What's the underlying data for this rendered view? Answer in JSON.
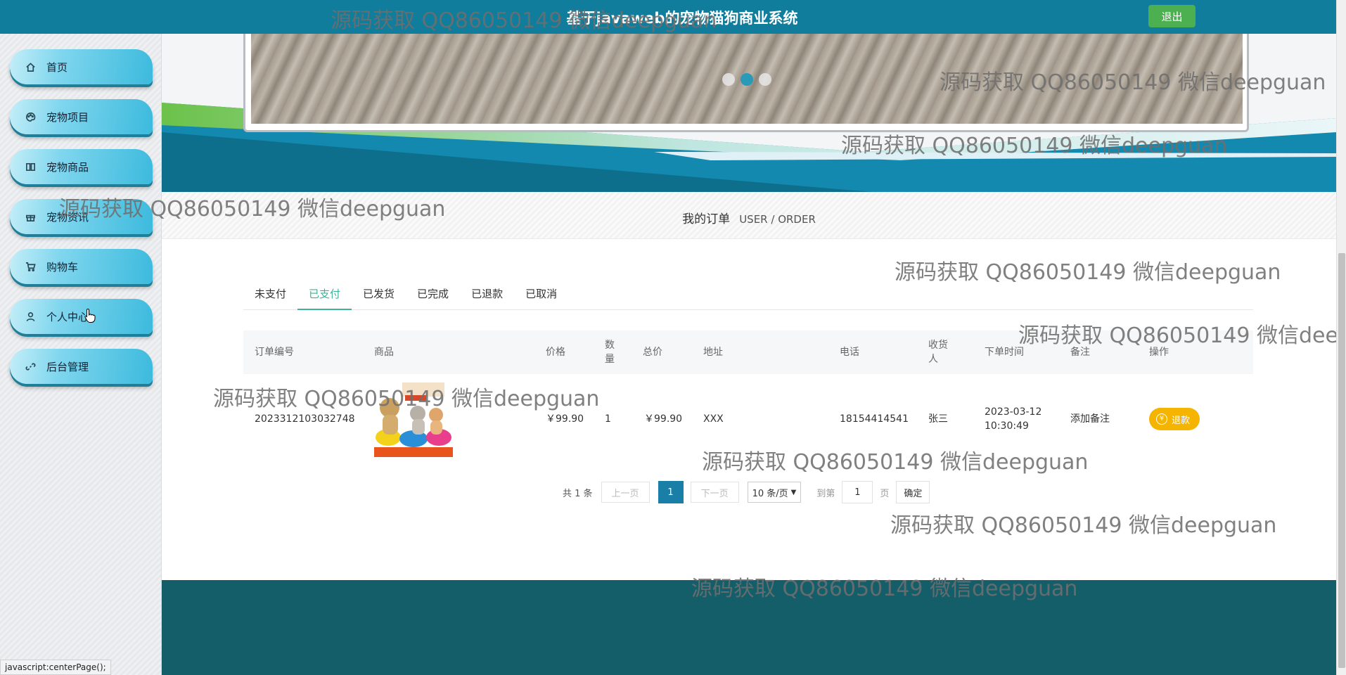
{
  "header": {
    "title": "基于javaweb的宠物猫狗商业系统",
    "logout_label": "退出"
  },
  "sidebar": {
    "items": [
      {
        "label": "首页",
        "icon": "home-icon"
      },
      {
        "label": "宠物项目",
        "icon": "palette-icon"
      },
      {
        "label": "宠物商品",
        "icon": "book-icon"
      },
      {
        "label": "宠物资讯",
        "icon": "gift-icon"
      },
      {
        "label": "购物车",
        "icon": "cart-icon"
      },
      {
        "label": "个人中心",
        "icon": "user-icon"
      },
      {
        "label": "后台管理",
        "icon": "link-icon"
      }
    ]
  },
  "banner": {
    "slides": 3,
    "active_slide": 2
  },
  "section": {
    "title_cn": "我的订单",
    "title_en": "USER / ORDER"
  },
  "tabs": [
    "未支付",
    "已支付",
    "已发货",
    "已完成",
    "已退款",
    "已取消"
  ],
  "active_tab": "已支付",
  "table": {
    "headers": {
      "order_no": "订单编号",
      "product": "商品",
      "price": "价格",
      "qty": "数量",
      "total": "总价",
      "address": "地址",
      "phone": "电话",
      "receiver": "收货人",
      "order_time": "下单时间",
      "remark": "备注",
      "action": "操作"
    },
    "rows": [
      {
        "order_no": "2023312103032748",
        "price": "￥99.90",
        "qty": "1",
        "total": "￥99.90",
        "address": "XXX",
        "phone": "18154414541",
        "receiver": "张三",
        "order_time": "2023-03-12 10:30:49",
        "remark": "添加备注",
        "action": "退款"
      }
    ]
  },
  "pager": {
    "total": "共 1 条",
    "prev": "上一页",
    "current": "1",
    "next": "下一页",
    "page_size": "10 条/页",
    "goto_prefix": "到第",
    "goto_value": "1",
    "goto_suffix": "页",
    "confirm": "确定"
  },
  "status_bar": "javascript:centerPage();",
  "watermark": "源码获取 QQ86050149 微信deepguan",
  "colors": {
    "topbar": "#0f7d9b",
    "accent_tab": "#3eb39a",
    "logout": "#4caf50",
    "refund": "#f5b400",
    "footer": "#145e6a"
  }
}
